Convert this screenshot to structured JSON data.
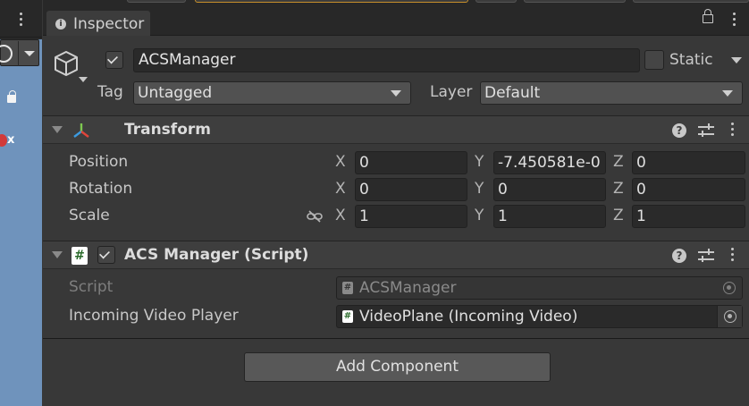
{
  "tab": {
    "title": "Inspector",
    "icon": "info-icon"
  },
  "game_object": {
    "active": true,
    "name": "ACSManager",
    "static_label": "Static",
    "static": false,
    "tag_label": "Tag",
    "tag_value": "Untagged",
    "layer_label": "Layer",
    "layer_value": "Default"
  },
  "transform": {
    "title": "Transform",
    "axis_x": "X",
    "axis_y": "Y",
    "axis_z": "Z",
    "position": {
      "label": "Position",
      "x": "0",
      "y": "-7.450581e-0",
      "z": "0"
    },
    "rotation": {
      "label": "Rotation",
      "x": "0",
      "y": "0",
      "z": "0"
    },
    "scale": {
      "label": "Scale",
      "x": "1",
      "y": "1",
      "z": "1"
    }
  },
  "script_component": {
    "title": "ACS Manager (Script)",
    "enabled": true,
    "script_label": "Script",
    "script_value": "ACSManager",
    "video_label": "Incoming Video Player",
    "video_value": "VideoPlane (Incoming Video)"
  },
  "add_component_label": "Add Component",
  "scene_strip": {
    "x_label": "x"
  },
  "colors": {
    "panel_bg": "#383838",
    "field_bg": "#2a2a2a",
    "scene_blue": "#6f93bc",
    "script_icon_green": "#2a6a2a"
  }
}
